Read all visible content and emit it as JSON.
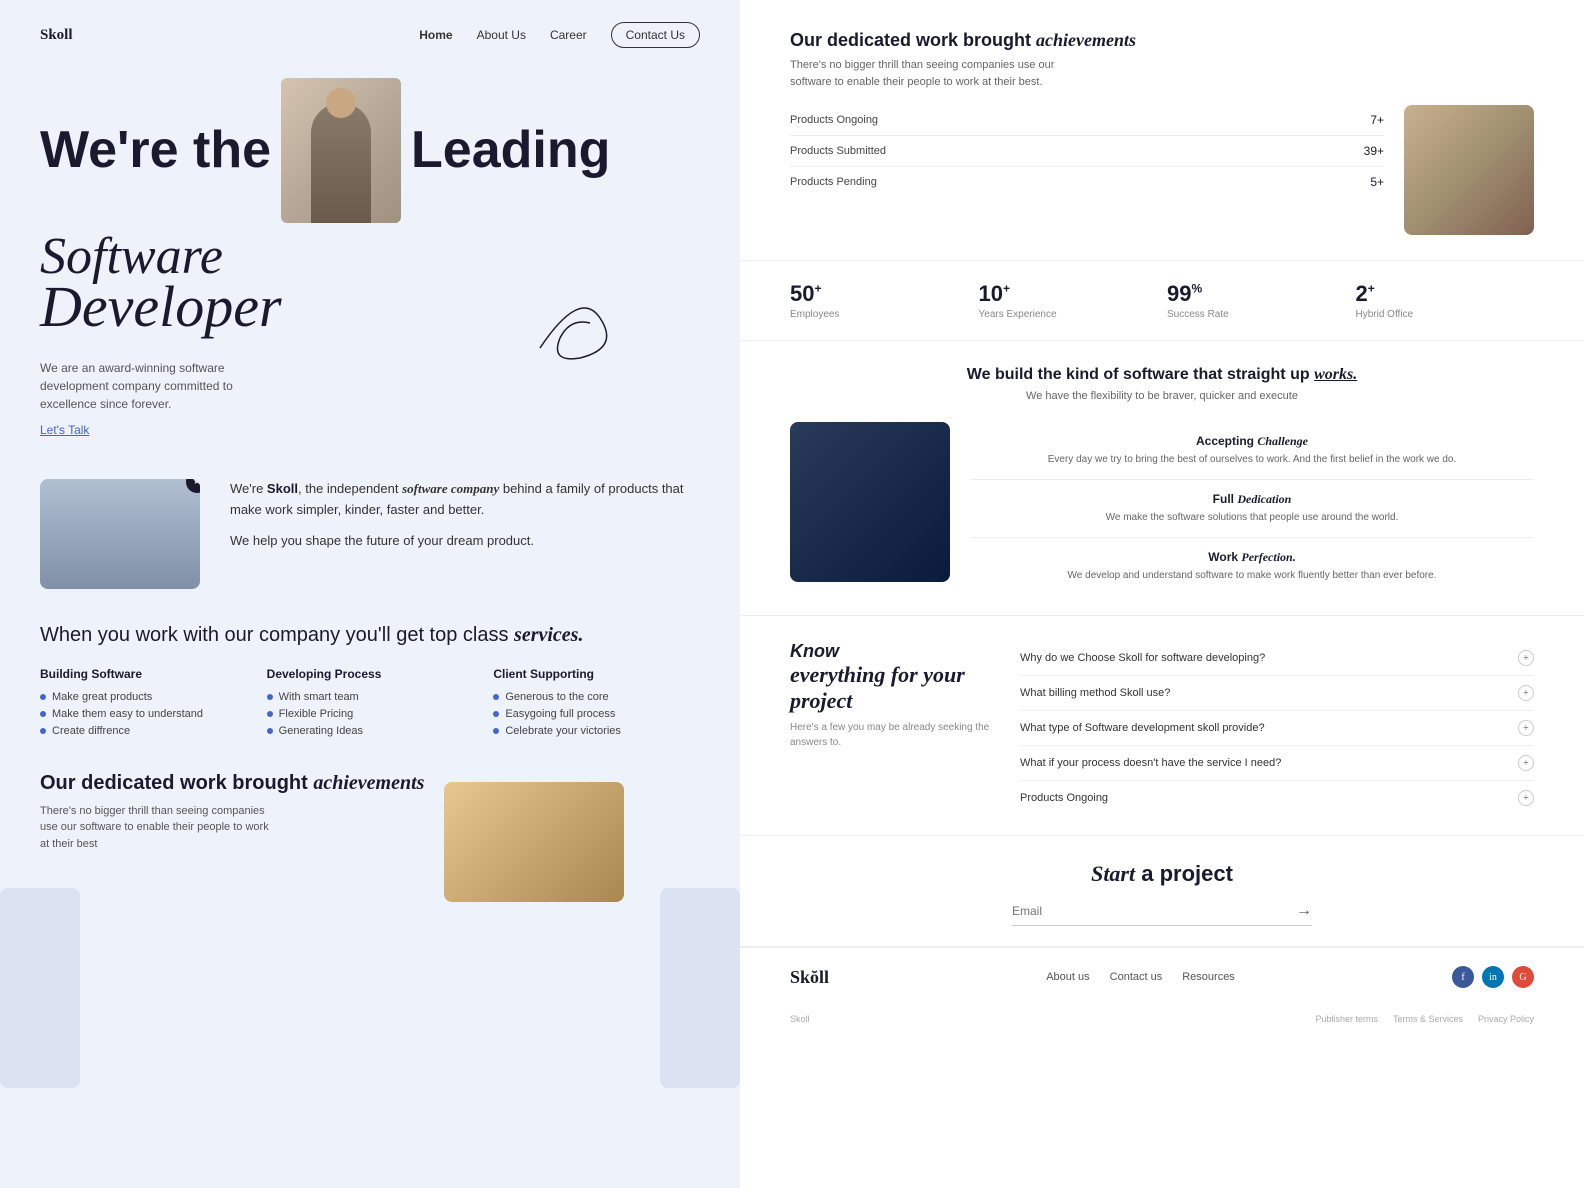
{
  "brand": {
    "logo": "Skoll",
    "logo_footer": "Skŏll"
  },
  "nav": {
    "home": "Home",
    "about": "About Us",
    "career": "Career",
    "contact": "Contact Us"
  },
  "hero": {
    "line1": "We're the",
    "line2": "Leading",
    "italic": "Software",
    "line3": "Developer",
    "subtitle": "We are an award-winning software development company committed to excellence since forever.",
    "cta": "Let's Talk"
  },
  "about": {
    "text_normal": "We're ",
    "text_bold": "Skoll",
    "text_rest": ", the independent ",
    "text_italic": "software company",
    "text_end": " behind a family of products that make work simpler, kinder, faster and better.",
    "subtext": "We help you shape the future of your dream product."
  },
  "services": {
    "title_normal": "When you work with our company you'll get top class ",
    "title_italic": "services.",
    "columns": [
      {
        "heading": "Building Software",
        "items": [
          "Make great products",
          "Make them easy to understand",
          "Create diffrence"
        ]
      },
      {
        "heading": "Developing Process",
        "items": [
          "With smart team",
          "Flexible Pricing",
          "Generating Ideas"
        ]
      },
      {
        "heading": "Client Supporting",
        "items": [
          "Generous to the core",
          "Easygoing full process",
          "Celebrate your victories"
        ]
      }
    ]
  },
  "achievements_left": {
    "title_normal": "Our dedicated work brought ",
    "title_italic": "achievements",
    "description": "There's no bigger thrill than seeing companies use our software to enable their people to work at their best"
  },
  "achievements_right": {
    "title_normal": "Our dedicated work brought ",
    "title_italic": "achievements",
    "description": "There's no bigger thrill than seeing companies use our software to enable their people to work at their best.",
    "stats": [
      {
        "label": "Products Ongoing",
        "value": "7+"
      },
      {
        "label": "Products Submitted",
        "value": "39+"
      },
      {
        "label": "Products Pending",
        "value": "5+"
      }
    ]
  },
  "numbers": [
    {
      "value": "50",
      "sup": "+",
      "label": "Employees"
    },
    {
      "value": "10",
      "sup": "+",
      "label": "Years Experience"
    },
    {
      "value": "99",
      "sup": "%",
      "label": "Success Rate"
    },
    {
      "value": "2",
      "sup": "+",
      "label": "Hybrid Office"
    }
  ],
  "works": {
    "title_normal": "We build the kind of software that straight up ",
    "title_italic": "works.",
    "subtitle": "We have the flexibility to be braver, quicker and execute",
    "items": [
      {
        "title_normal": "Accepting ",
        "title_italic": "Challenge",
        "desc": "Every day we try to bring the best of ourselves to work. And the first belief in the work we do."
      },
      {
        "title_normal": "Full ",
        "title_italic": "Dedication",
        "desc": "We make the software solutions that people use around the world."
      },
      {
        "title_normal": "Work ",
        "title_italic": "Perfection.",
        "desc": "We develop and understand software to make work fluently better than ever before."
      }
    ]
  },
  "faq": {
    "title_italic": "Know",
    "title_normal": "everything for your project",
    "description": "Here's a few you may be already seeking the answers to.",
    "items": [
      "Why do we Choose Skoll for software developing?",
      "What billing method Skoll use?",
      "What type of Software development skoll provide?",
      "What if your process doesn't have the service I need?",
      "Products Ongoing"
    ]
  },
  "start_project": {
    "title_normal": " a project",
    "title_italic": "Start",
    "email_placeholder": "Email"
  },
  "footer": {
    "about": "About us",
    "contact": "Contact us",
    "resources": "Resources",
    "publisher_terms": "Publisher terms",
    "terms_services": "Terms & Services",
    "privacy_policy": "Privacy Policy",
    "copyright": "Skoll"
  }
}
